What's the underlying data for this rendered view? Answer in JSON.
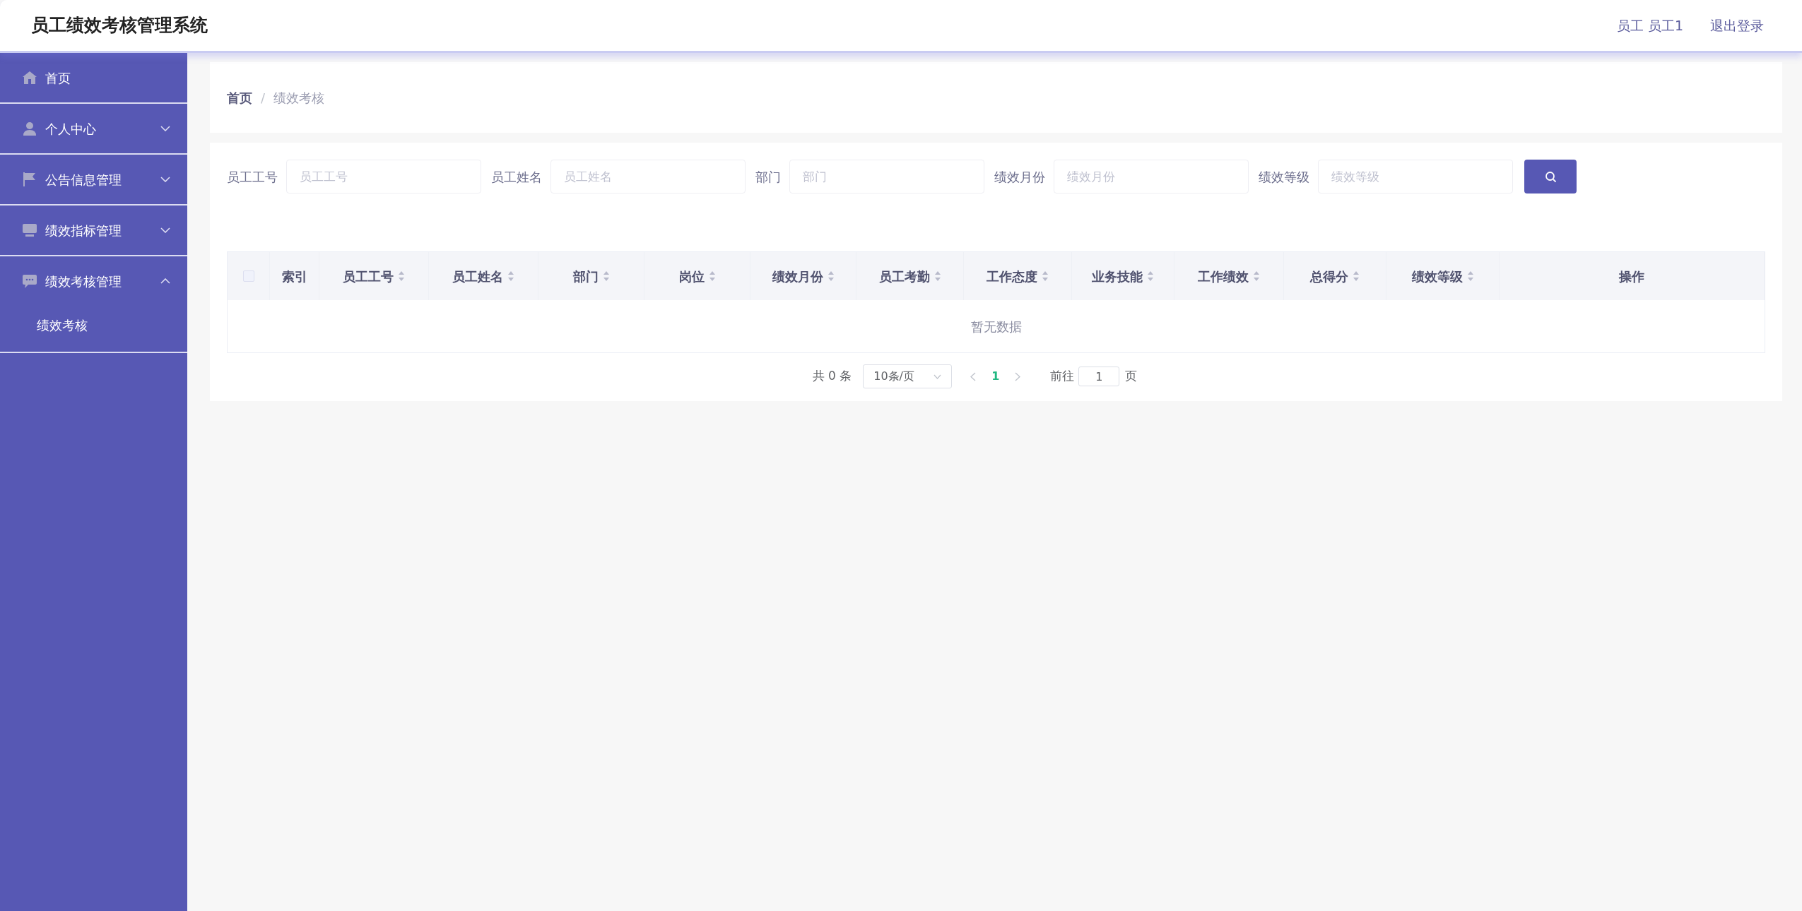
{
  "header": {
    "title": "员工绩效考核管理系统",
    "user": "员工 员工1",
    "logout": "退出登录"
  },
  "sidebar": {
    "items": [
      {
        "label": "首页",
        "kind": "link"
      },
      {
        "label": "个人中心",
        "kind": "group",
        "expanded": false
      },
      {
        "label": "公告信息管理",
        "kind": "group",
        "expanded": false
      },
      {
        "label": "绩效指标管理",
        "kind": "group",
        "expanded": false
      },
      {
        "label": "绩效考核管理",
        "kind": "group",
        "expanded": true,
        "children": [
          {
            "label": "绩效考核"
          }
        ]
      }
    ]
  },
  "breadcrumb": {
    "separator": "/",
    "items": [
      "首页",
      "绩效考核"
    ]
  },
  "filters": [
    {
      "label": "员工工号",
      "placeholder": "员工工号"
    },
    {
      "label": "员工姓名",
      "placeholder": "员工姓名"
    },
    {
      "label": "部门",
      "placeholder": "部门"
    },
    {
      "label": "绩效月份",
      "placeholder": "绩效月份"
    },
    {
      "label": "绩效等级",
      "placeholder": "绩效等级"
    }
  ],
  "table": {
    "select_all_checked": false,
    "columns": [
      {
        "label": "索引",
        "sortable": false
      },
      {
        "label": "员工工号",
        "sortable": true
      },
      {
        "label": "员工姓名",
        "sortable": true
      },
      {
        "label": "部门",
        "sortable": true
      },
      {
        "label": "岗位",
        "sortable": true
      },
      {
        "label": "绩效月份",
        "sortable": true
      },
      {
        "label": "员工考勤",
        "sortable": true
      },
      {
        "label": "工作态度",
        "sortable": true
      },
      {
        "label": "业务技能",
        "sortable": true
      },
      {
        "label": "工作绩效",
        "sortable": true
      },
      {
        "label": "总得分",
        "sortable": true
      },
      {
        "label": "绩效等级",
        "sortable": true
      },
      {
        "label": "操作",
        "sortable": false
      }
    ],
    "empty_text": "暂无数据"
  },
  "pagination": {
    "total": "共 0 条",
    "page_size": "10条/页",
    "pages": [
      {
        "label": "1",
        "selected": true
      }
    ],
    "goto_label": "前往",
    "goto_value": "1",
    "goto_suffix": "页"
  }
}
